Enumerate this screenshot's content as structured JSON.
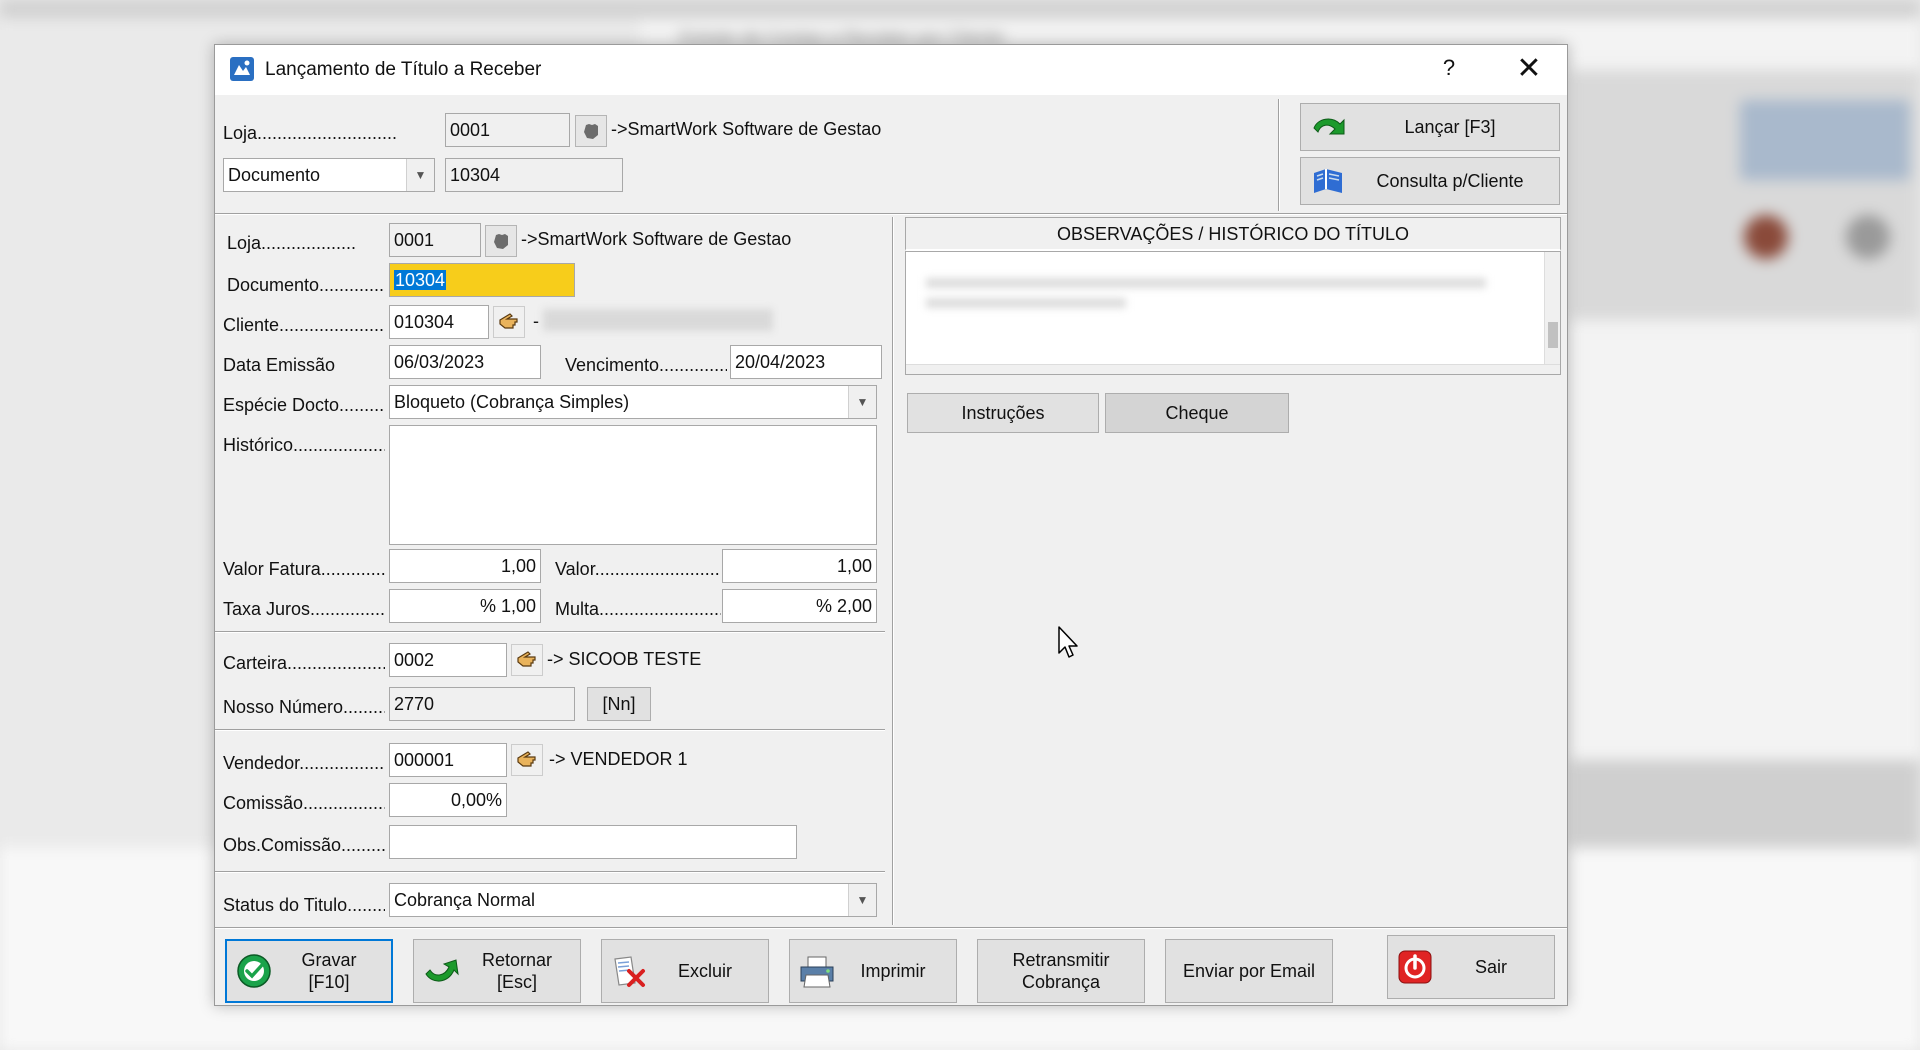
{
  "background_app": {
    "title": "Extrato de Contas a Receber por Cliente"
  },
  "window": {
    "title": "Lançamento de Título a Receber",
    "help": "?",
    "close": "✕"
  },
  "search": {
    "loja_label": "Loja..................................",
    "loja_value": "0001",
    "loja_desc": "->SmartWork Software de Gestao",
    "search_type": "Documento",
    "search_value": "10304"
  },
  "actions": {
    "lancar": "Lançar  [F3]",
    "consulta": "Consulta p/Cliente"
  },
  "form": {
    "loja_label": "Loja..............................",
    "loja_value": "0001",
    "loja_desc": "->SmartWork Software de Gestao",
    "documento_label": "Documento...............",
    "documento_value": "10304",
    "cliente_label": "Cliente.........................",
    "cliente_value": "010304",
    "cliente_desc": "-",
    "data_emissao_label": "Data Emissão",
    "data_emissao_value": "06/03/2023",
    "vencimento_label": "Vencimento...............",
    "vencimento_value": "20/04/2023",
    "especie_label": "Espécie Docto..........",
    "especie_value": "Bloqueto (Cobrança Simples)",
    "historico_label": "Histórico.......................",
    "historico_value": "",
    "valor_fatura_label": "Valor Fatura.............",
    "valor_fatura_value": "1,00",
    "valor_label": "Valor..............................",
    "valor_value": "1,00",
    "taxa_juros_label": "Taxa Juros...............",
    "taxa_juros_value": "% 1,00",
    "multa_label": "Multa..............................",
    "multa_value": "% 2,00",
    "carteira_label": "Carteira........................",
    "carteira_value": "0002",
    "carteira_desc": "-> SICOOB TESTE",
    "nosso_numero_label": "Nosso Número..........",
    "nosso_numero_value": "2770",
    "nn_button": "[Nn]",
    "vendedor_label": "Vendedor.....................",
    "vendedor_value": "000001",
    "vendedor_desc": "-> VENDEDOR 1",
    "comissao_label": "Comissão......................",
    "comissao_value": "0,00%",
    "obs_comissao_label": "Obs.Comissão..........",
    "obs_comissao_value": "",
    "status_label": "Status do Titulo........",
    "status_value": "Cobrança Normal"
  },
  "obs": {
    "header": "OBSERVAÇÕES / HISTÓRICO DO TÍTULO",
    "tab_instrucoes": "Instruções",
    "tab_cheque": "Cheque"
  },
  "bottom": {
    "gravar_1": "Gravar",
    "gravar_2": "[F10]",
    "retornar_1": "Retornar",
    "retornar_2": "[Esc]",
    "excluir": "Excluir",
    "imprimir": "Imprimir",
    "retransmitir_1": "Retransmitir",
    "retransmitir_2": "Cobrança",
    "email": "Enviar por Email",
    "sair": "Sair"
  },
  "colors": {
    "highlight": "#f7cd1b",
    "selection": "#0078d7",
    "dialog_bg": "#f0f0f0"
  }
}
